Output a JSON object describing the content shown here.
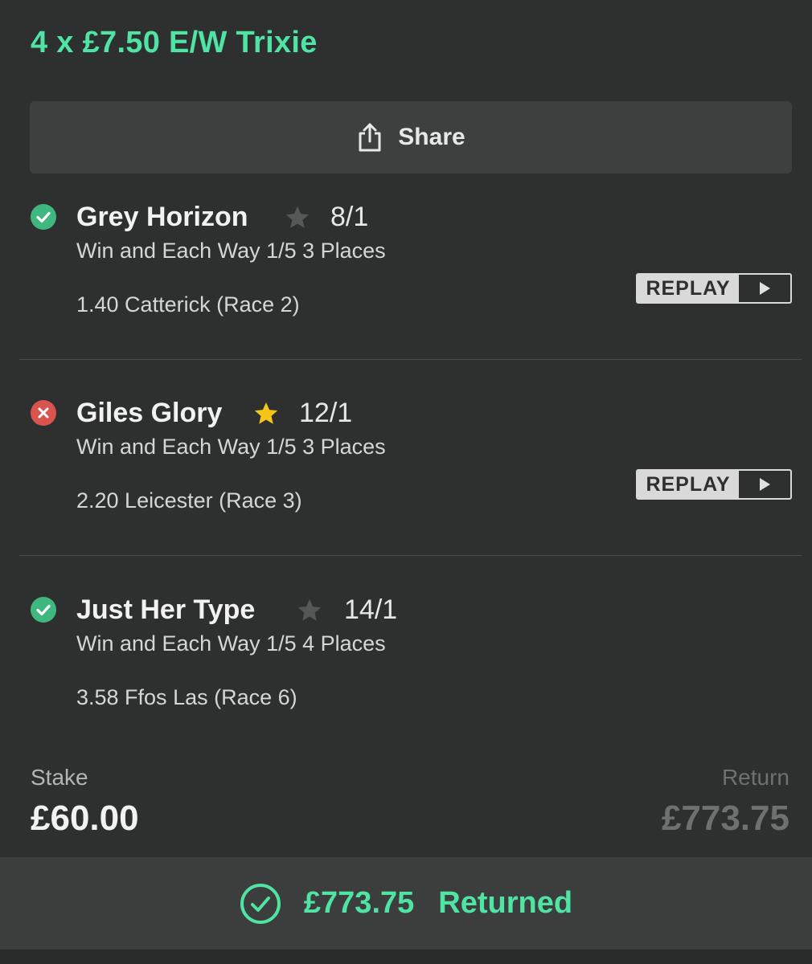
{
  "bet": {
    "title": "4 x £7.50 E/W Trixie"
  },
  "share": {
    "label": "Share",
    "icon": "share-icon"
  },
  "selections": [
    {
      "status": "won",
      "status_icon": "check-circle-icon",
      "status_color": "#3fb87f",
      "name": "Grey Horizon",
      "favourite": false,
      "star_color": "#555857",
      "odds": "8/1",
      "market": "Win and Each Way 1/5 3 Places",
      "event": "1.40 Catterick (Race 2)",
      "replay_label": "REPLAY"
    },
    {
      "status": "lost",
      "status_icon": "x-circle-icon",
      "status_color": "#d9534f",
      "name": "Giles Glory",
      "favourite": true,
      "star_color": "#f5c518",
      "odds": "12/1",
      "market": "Win and Each Way 1/5 3 Places",
      "event": "2.20 Leicester (Race 3)",
      "replay_label": "REPLAY"
    },
    {
      "status": "won",
      "status_icon": "check-circle-icon",
      "status_color": "#3fb87f",
      "name": "Just Her Type",
      "favourite": false,
      "star_color": "#555857",
      "odds": "14/1",
      "market": "Win and Each Way 1/5 4 Places",
      "event": "3.58 Ffos Las (Race 6)",
      "replay_label": null
    }
  ],
  "summary": {
    "stake_label": "Stake",
    "stake_value": "£60.00",
    "return_label": "Return",
    "return_value": "£773.75"
  },
  "returned": {
    "amount": "£773.75",
    "label": "Returned",
    "icon": "check-circle-icon"
  },
  "colors": {
    "accent": "#4fe3a4",
    "background": "#2d302f"
  }
}
